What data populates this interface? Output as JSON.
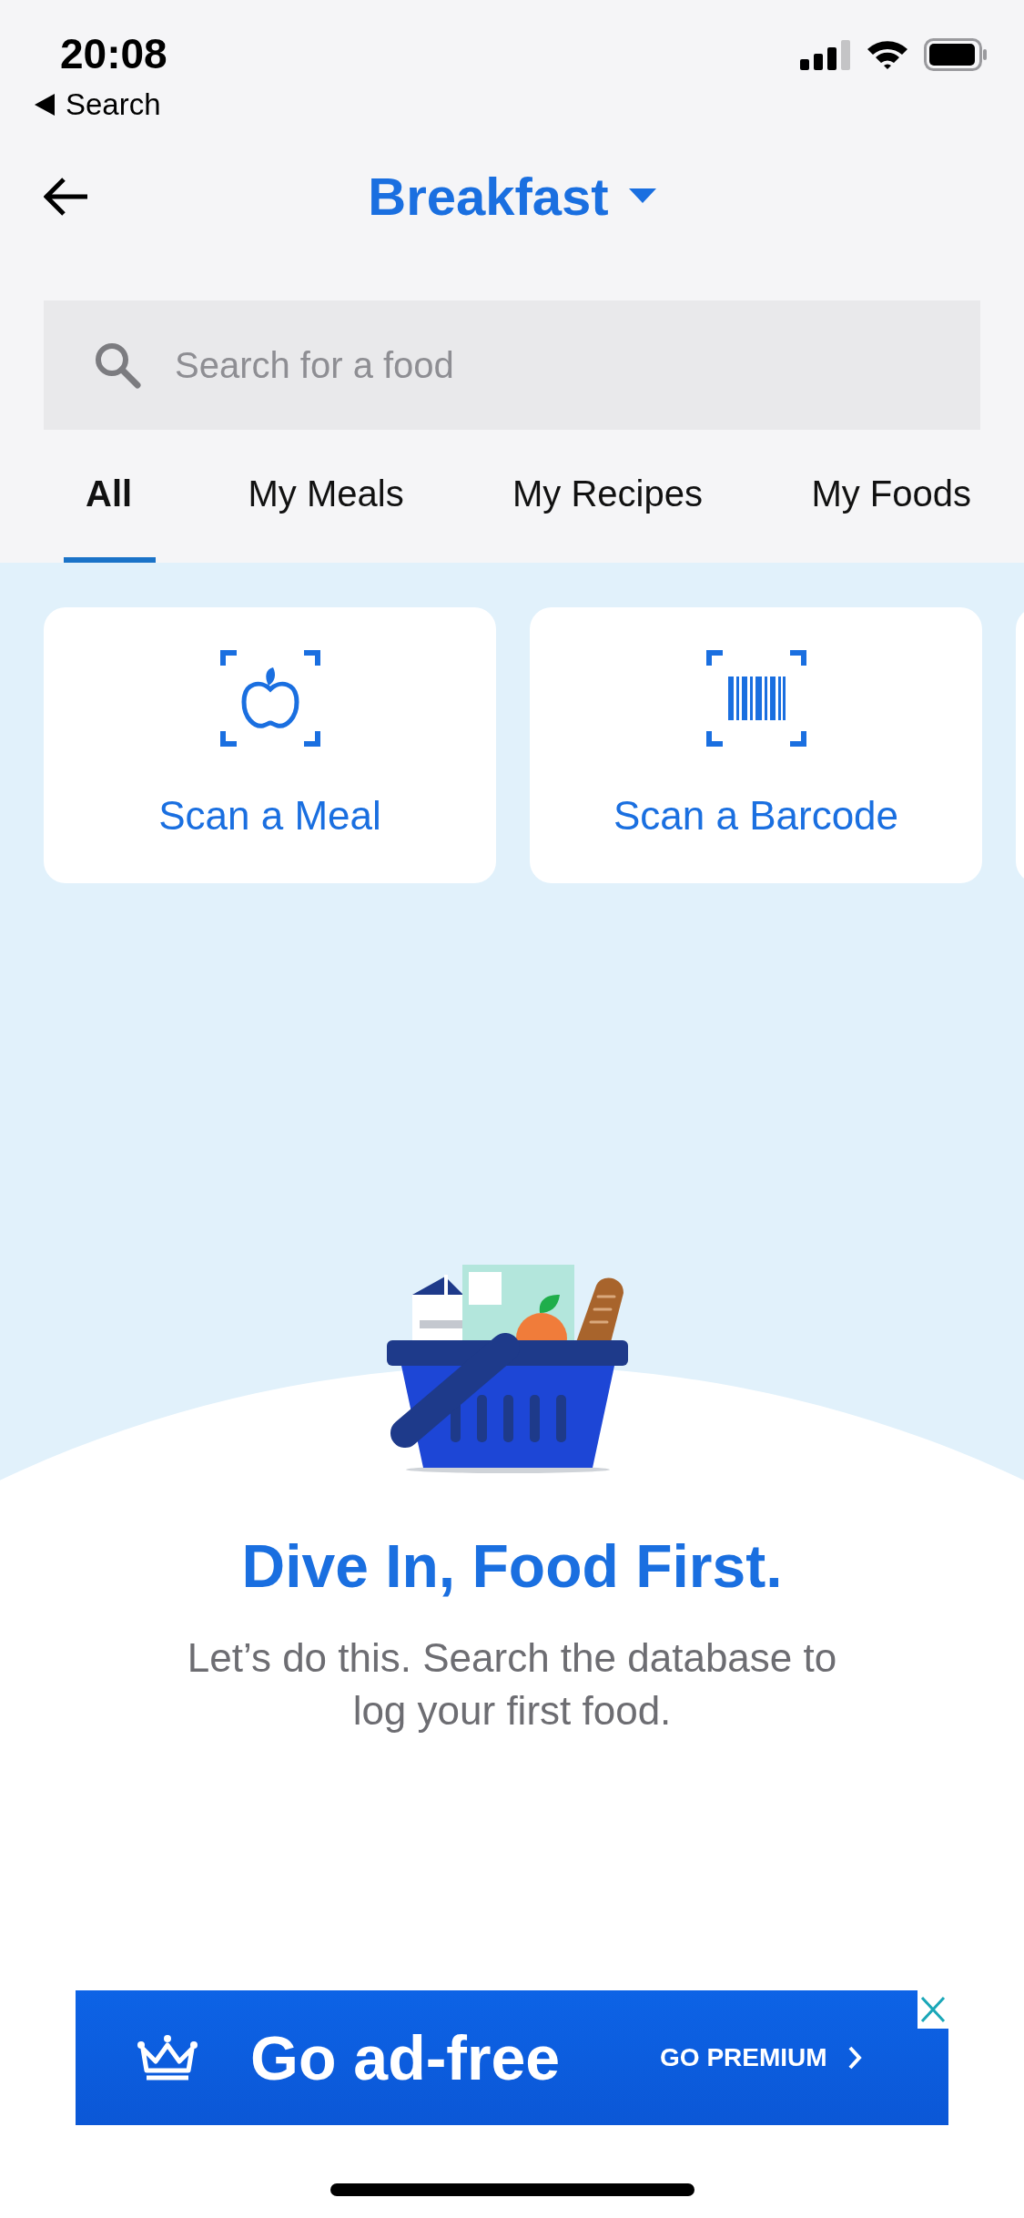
{
  "status_bar": {
    "time": "20:08",
    "back_label": "Search"
  },
  "header": {
    "title": "Breakfast"
  },
  "search": {
    "placeholder": "Search for a food"
  },
  "tabs": [
    {
      "label": "All",
      "selected": true
    },
    {
      "label": "My Meals",
      "selected": false
    },
    {
      "label": "My Recipes",
      "selected": false
    },
    {
      "label": "My Foods",
      "selected": false
    }
  ],
  "scan_cards": [
    {
      "kind": "meal",
      "label": "Scan a Meal"
    },
    {
      "kind": "barcode",
      "label": "Scan a Barcode"
    }
  ],
  "empty_state": {
    "title": "Dive In, Food First.",
    "message": "Let’s do this. Search the database to log your first food."
  },
  "ad": {
    "headline": "Go ad-free",
    "cta": "GO PREMIUM"
  }
}
